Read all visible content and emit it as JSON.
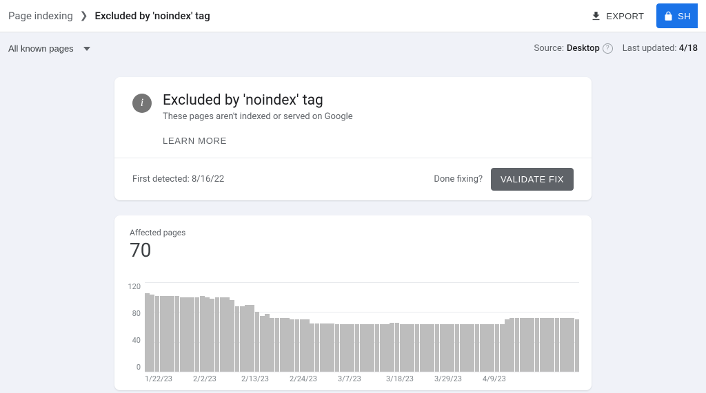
{
  "breadcrumb": {
    "parent": "Page indexing",
    "current": "Excluded by 'noindex' tag"
  },
  "topbar": {
    "export": "EXPORT",
    "share": "SH"
  },
  "subbar": {
    "filter": "All known pages",
    "source_prefix": "Source:",
    "source_value": "Desktop",
    "updated_prefix": "Last updated:",
    "updated_value": "4/18"
  },
  "issue": {
    "title": "Excluded by 'noindex' tag",
    "subtitle": "These pages aren't indexed or served on Google",
    "learn_more": "LEARN MORE",
    "first_detected": "First detected: 8/16/22",
    "done_fixing": "Done fixing?",
    "validate": "VALIDATE FIX"
  },
  "affected": {
    "label": "Affected pages",
    "count": "70"
  },
  "chart_data": {
    "type": "bar",
    "title": "Affected pages",
    "xlabel": "",
    "ylabel": "",
    "ylim": [
      0,
      120
    ],
    "y_ticks": [
      "120",
      "80",
      "40",
      "0"
    ],
    "x_ticks": [
      "1/22/23",
      "2/2/23",
      "2/13/23",
      "2/24/23",
      "3/7/23",
      "3/18/23",
      "3/29/23",
      "4/9/23",
      ""
    ],
    "categories": [
      "1/22/23",
      "1/23/23",
      "1/24/23",
      "1/25/23",
      "1/26/23",
      "1/27/23",
      "1/28/23",
      "1/29/23",
      "1/30/23",
      "1/31/23",
      "2/1/23",
      "2/2/23",
      "2/3/23",
      "2/4/23",
      "2/5/23",
      "2/6/23",
      "2/7/23",
      "2/8/23",
      "2/9/23",
      "2/10/23",
      "2/11/23",
      "2/12/23",
      "2/13/23",
      "2/14/23",
      "2/15/23",
      "2/16/23",
      "2/17/23",
      "2/18/23",
      "2/19/23",
      "2/20/23",
      "2/21/23",
      "2/22/23",
      "2/23/23",
      "2/24/23",
      "2/25/23",
      "2/26/23",
      "2/27/23",
      "2/28/23",
      "3/1/23",
      "3/2/23",
      "3/3/23",
      "3/4/23",
      "3/5/23",
      "3/6/23",
      "3/7/23",
      "3/8/23",
      "3/9/23",
      "3/10/23",
      "3/11/23",
      "3/12/23",
      "3/13/23",
      "3/14/23",
      "3/15/23",
      "3/16/23",
      "3/17/23",
      "3/18/23",
      "3/19/23",
      "3/20/23",
      "3/21/23",
      "3/22/23",
      "3/23/23",
      "3/24/23",
      "3/25/23",
      "3/26/23",
      "3/27/23",
      "3/28/23",
      "3/29/23",
      "3/30/23",
      "3/31/23",
      "4/1/23",
      "4/2/23",
      "4/3/23",
      "4/4/23",
      "4/5/23",
      "4/6/23",
      "4/7/23",
      "4/8/23",
      "4/9/23",
      "4/10/23",
      "4/11/23",
      "4/12/23",
      "4/13/23",
      "4/14/23",
      "4/15/23",
      "4/16/23",
      "4/17/23",
      "4/18/23"
    ],
    "values": [
      105,
      103,
      102,
      102,
      102,
      102,
      102,
      100,
      100,
      100,
      100,
      102,
      100,
      98,
      100,
      100,
      100,
      96,
      88,
      88,
      90,
      90,
      80,
      75,
      78,
      72,
      72,
      72,
      72,
      70,
      70,
      70,
      70,
      65,
      65,
      65,
      65,
      65,
      64,
      64,
      64,
      64,
      64,
      64,
      64,
      64,
      64,
      64,
      64,
      66,
      66,
      64,
      64,
      64,
      64,
      64,
      64,
      64,
      64,
      64,
      64,
      64,
      64,
      64,
      64,
      64,
      64,
      64,
      64,
      64,
      64,
      64,
      70,
      72,
      72,
      72,
      72,
      72,
      72,
      72,
      72,
      72,
      72,
      72,
      72,
      72,
      70
    ]
  }
}
